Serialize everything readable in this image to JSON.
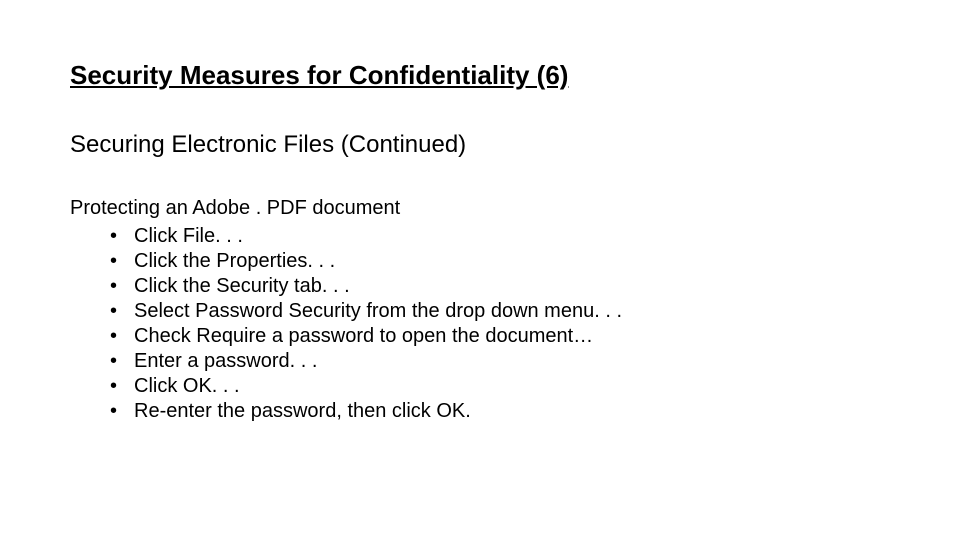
{
  "title": "Security Measures for Confidentiality (6)",
  "subtitle": "Securing Electronic Files (Continued)",
  "intro": "Protecting an Adobe . PDF document",
  "steps": [
    "Click File. . .",
    "Click the Properties. . .",
    "Click the Security tab. . .",
    "Select Password Security from the drop down menu. . .",
    "Check Require a password to open the document…",
    "Enter a password. . .",
    "Click OK. . .",
    "Re-enter the password, then click OK."
  ]
}
